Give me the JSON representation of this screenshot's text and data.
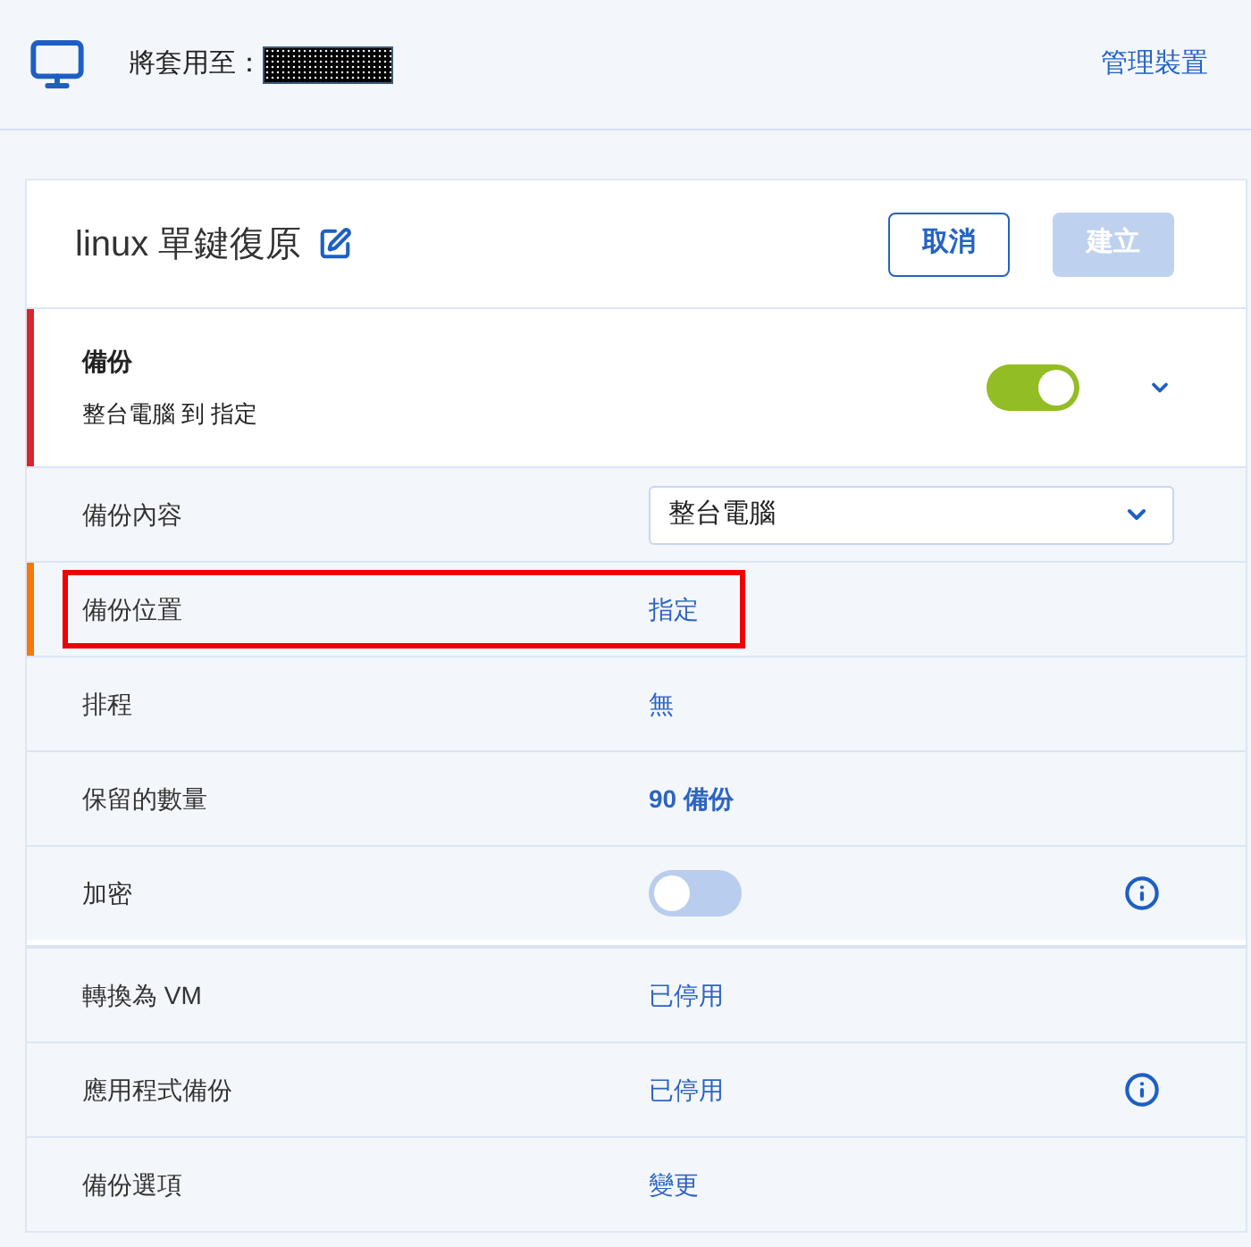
{
  "header": {
    "apply_label": "將套用至：",
    "link": "管理裝置"
  },
  "plan": {
    "title": "linux 單鍵復原",
    "buttons": [
      {
        "label": "取消",
        "kind": "outline",
        "disabled": false
      },
      {
        "label": "建立",
        "kind": "primary",
        "disabled": true
      }
    ]
  },
  "backup": {
    "title": "備份",
    "summary": "整台電腦 到 指定",
    "on": true,
    "expanded": true,
    "color": "#d9262c"
  },
  "row_groups": [
    {
      "rows": [
        {
          "label": "備份內容",
          "kind": "select",
          "value": "整台電腦",
          "highlighted": false,
          "info": false
        },
        {
          "label": "備份位置",
          "kind": "link",
          "value": "指定",
          "color": "#f5780a",
          "highlighted": true,
          "info": false
        },
        {
          "label": "排程",
          "kind": "link",
          "value": "無",
          "highlighted": false,
          "info": false
        },
        {
          "label": "保留的數量",
          "kind": "count",
          "value": "90 備份",
          "highlighted": false,
          "info": false
        },
        {
          "label": "加密",
          "kind": "toggle",
          "on": false,
          "highlighted": false,
          "info": true
        }
      ]
    },
    {
      "rows": [
        {
          "label": "轉換為 VM",
          "kind": "link",
          "value": "已停用",
          "highlighted": false,
          "info": false
        },
        {
          "label": "應用程式備份",
          "kind": "link",
          "value": "已停用",
          "highlighted": false,
          "info": true
        },
        {
          "label": "備份選項",
          "kind": "link",
          "value": "變更",
          "highlighted": false,
          "info": false
        }
      ]
    }
  ]
}
